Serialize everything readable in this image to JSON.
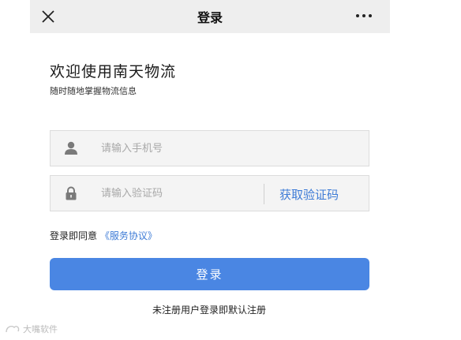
{
  "navbar": {
    "title": "登录",
    "close_icon": "close-icon",
    "more_icon": "more-dots-icon"
  },
  "welcome": {
    "title": "欢迎使用南天物流",
    "subtitle": "随时随地掌握物流信息"
  },
  "phone_field": {
    "icon": "user-icon",
    "placeholder": "请输入手机号",
    "value": ""
  },
  "code_field": {
    "icon": "lock-icon",
    "placeholder": "请输入验证码",
    "value": "",
    "get_code_label": "获取验证码"
  },
  "agreement": {
    "prefix": "登录即同意",
    "link_label": "《服务协议》"
  },
  "login_button": {
    "label": "登录",
    "color": "#4a86e3"
  },
  "hint": "未注册用户登录即默认注册",
  "watermark": "大嘴软件",
  "colors": {
    "accent": "#3d7bd6",
    "navbar_bg": "#eeeeee",
    "field_bg": "#f4f4f4"
  }
}
